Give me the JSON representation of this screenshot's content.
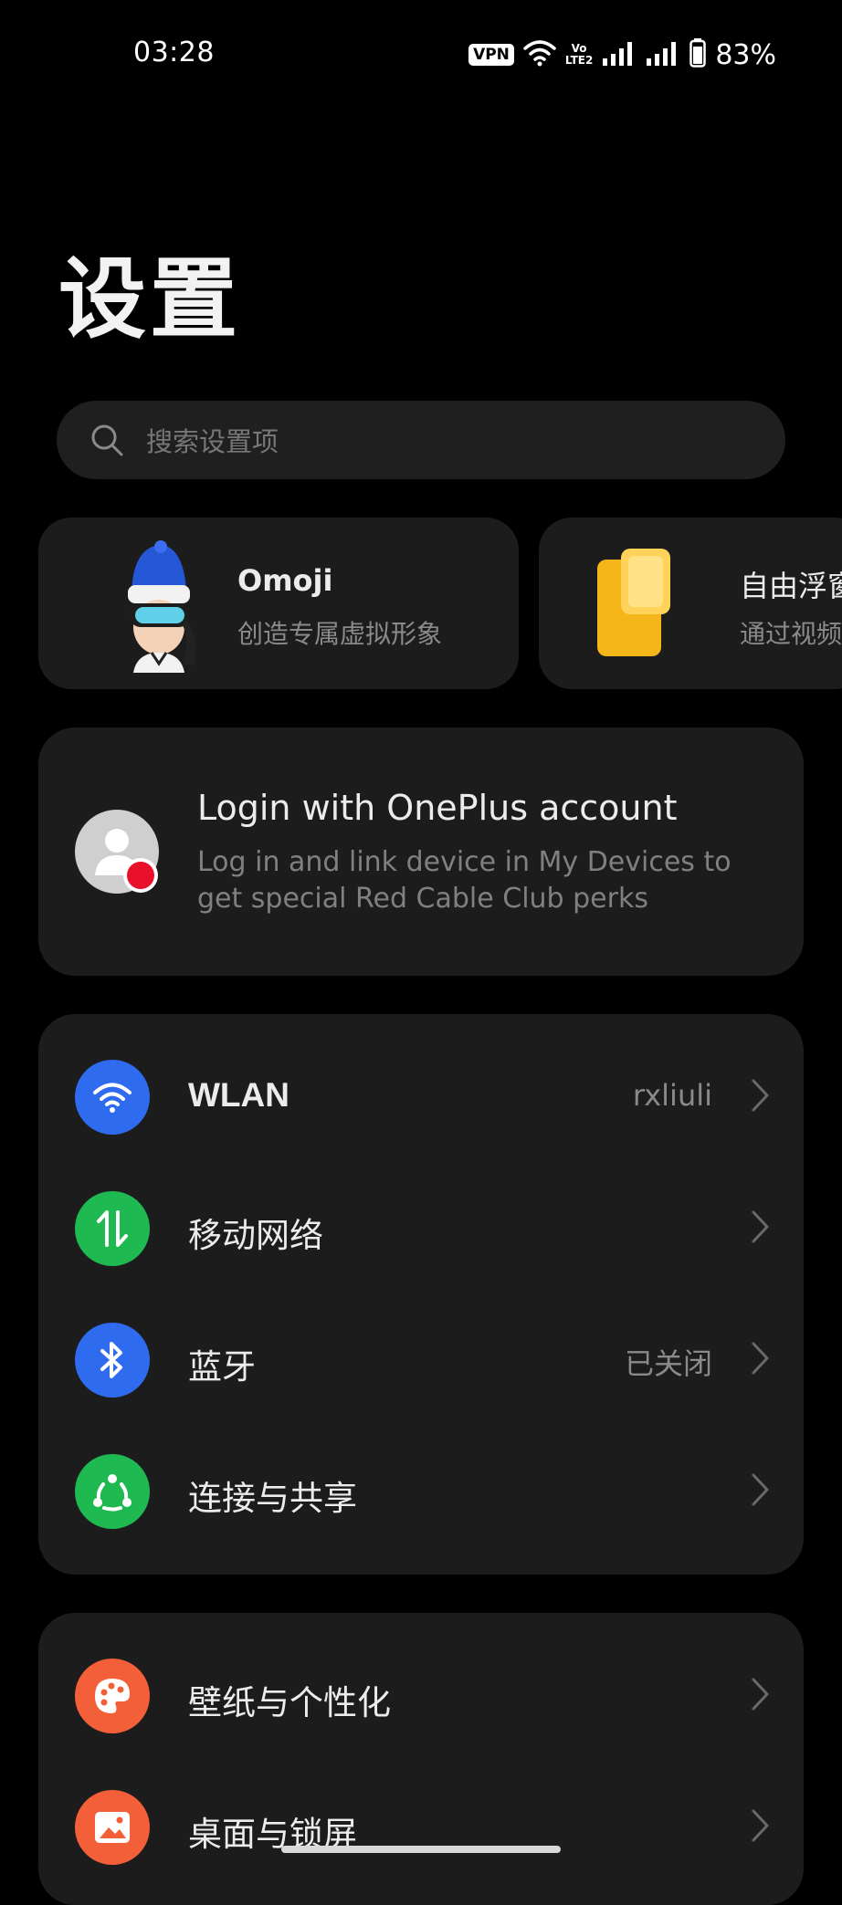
{
  "status_bar": {
    "time": "03:28",
    "vpn": "VPN",
    "volte_top": "Vo",
    "volte_bottom": "LTE2",
    "battery": "83%"
  },
  "page": {
    "title": "设置"
  },
  "search": {
    "placeholder": "搜索设置项",
    "icon": "search-icon"
  },
  "feature_cards": [
    {
      "title": "Omoji",
      "subtitle": "创造专属虚拟形象",
      "icon": "omoji-avatar"
    },
    {
      "title": "自由浮窗",
      "subtitle": "通过视频",
      "icon": "floating-window-icon"
    }
  ],
  "account": {
    "title": "Login with OnePlus account",
    "subtitle": "Log in and link device in My Devices to get special Red Cable Club perks",
    "icon": "account-avatar-icon"
  },
  "group1": [
    {
      "label": "WLAN",
      "value": "rxliuli",
      "icon": "wifi-icon",
      "color": "#2f6bef"
    },
    {
      "label": "移动网络",
      "value": "",
      "icon": "mobile-data-icon",
      "color": "#1fb952"
    },
    {
      "label": "蓝牙",
      "value": "已关闭",
      "icon": "bluetooth-icon",
      "color": "#2f6bef"
    },
    {
      "label": "连接与共享",
      "value": "",
      "icon": "share-icon",
      "color": "#1fb952"
    }
  ],
  "group2": [
    {
      "label": "壁纸与个性化",
      "value": "",
      "icon": "palette-icon",
      "color": "#f25f38"
    },
    {
      "label": "桌面与锁屏",
      "value": "",
      "icon": "image-icon",
      "color": "#f25f38"
    }
  ]
}
